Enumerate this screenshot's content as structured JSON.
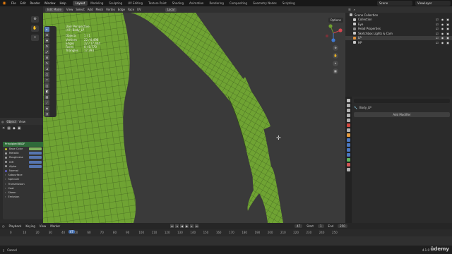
{
  "topbar": {
    "menu": [
      "File",
      "Edit",
      "Render",
      "Window",
      "Help"
    ],
    "workspaces": [
      "Layout",
      "Modeling",
      "Sculpting",
      "UV Editing",
      "Texture Paint",
      "Shading",
      "Animation",
      "Rendering",
      "Compositing",
      "Geometry Nodes",
      "Scripting"
    ],
    "active_workspace": "Layout",
    "scene": "Scene",
    "view_layer": "ViewLayer"
  },
  "viewport": {
    "mode": "Edit Mode",
    "header_items": [
      "View",
      "Select",
      "Add",
      "Mesh",
      "Vertex",
      "Edge",
      "Face",
      "UV"
    ],
    "transform_orientation": "Local",
    "options": "Options",
    "overlay_title": "User Perspective",
    "overlay_object": "(47) Body_LP",
    "stats": [
      {
        "label": "Objects",
        "value": "1 / 1"
      },
      {
        "label": "Vertices",
        "value": "22 / 8,498"
      },
      {
        "label": "Edges",
        "value": "22 / 17,444"
      },
      {
        "label": "Faces",
        "value": "0 / 8,770"
      },
      {
        "label": "Triangles",
        "value": "17,393"
      }
    ],
    "mesh_color": "#6fa333"
  },
  "shader": {
    "header": {
      "editor": "Object",
      "view": "View"
    },
    "node_title": "Principled BSDF",
    "props": [
      {
        "label": "Base Color",
        "dot": "yellow",
        "slot": "green"
      },
      {
        "label": "Metallic",
        "dot": "gray",
        "slot": "blue"
      },
      {
        "label": "Roughness",
        "dot": "gray",
        "slot": "blue"
      },
      {
        "label": "IOR",
        "dot": "gray",
        "slot": "blue"
      },
      {
        "label": "Alpha",
        "dot": "gray",
        "slot": "blue"
      },
      {
        "label": "Normal",
        "dot": "blue",
        "slot": "none"
      },
      {
        "label": "Subsurface",
        "dot": "none",
        "slot": "none"
      },
      {
        "label": "Specular",
        "dot": "none",
        "slot": "none"
      },
      {
        "label": "Transmission",
        "dot": "none",
        "slot": "none"
      },
      {
        "label": "Coat",
        "dot": "none",
        "slot": "none"
      },
      {
        "label": "Sheen",
        "dot": "none",
        "slot": "none"
      },
      {
        "label": "Emission",
        "dot": "none",
        "slot": "none"
      }
    ]
  },
  "outliner": {
    "title": "Scene Collection",
    "rows": [
      {
        "label": "Collection",
        "color": "#c7c7c7",
        "selected": false
      },
      {
        "label": "Eye",
        "color": "#c7c7c7",
        "selected": false
      },
      {
        "label": "Head Properties",
        "color": "#8a8a8a",
        "selected": false
      },
      {
        "label": "Sketchbox Lights & Cam",
        "color": "#c7c7c7",
        "selected": false
      },
      {
        "label": "LP",
        "color": "#e0913a",
        "selected": true
      },
      {
        "label": "HP",
        "color": "#c7c7c7",
        "selected": false
      }
    ]
  },
  "properties": {
    "object_name": "Body_LP",
    "add_modifier": "Add Modifier"
  },
  "timeline": {
    "header": [
      "Playback",
      "Keying",
      "View",
      "Marker"
    ],
    "current_frame": "47",
    "start_label": "Start",
    "start": "1",
    "end_label": "End",
    "end": "250",
    "ticks": [
      "0",
      "10",
      "20",
      "30",
      "40",
      "50",
      "60",
      "70",
      "80",
      "90",
      "100",
      "110",
      "120",
      "130",
      "140",
      "150",
      "160",
      "170",
      "180",
      "190",
      "200",
      "210",
      "220",
      "230",
      "240",
      "250"
    ]
  },
  "status": {
    "left": "Cancel",
    "version": "4.1.0"
  },
  "watermark": "ûdemy"
}
